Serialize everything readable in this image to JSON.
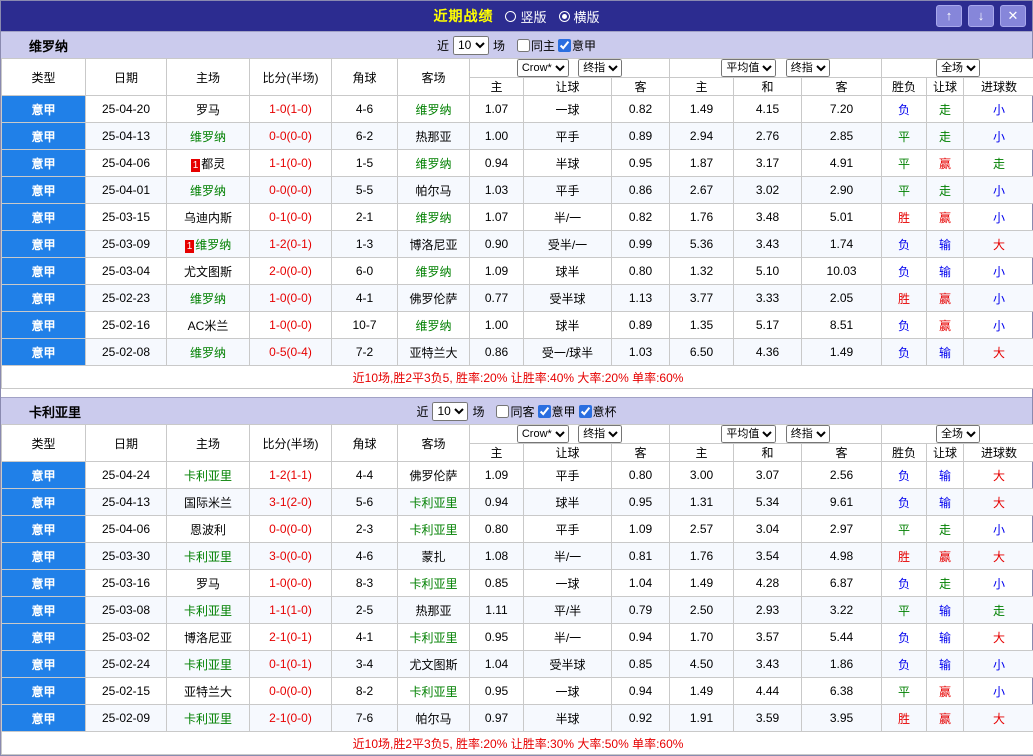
{
  "titlebar": {
    "title": "近期战绩",
    "layout_options": [
      {
        "label": "竖版",
        "selected": false
      },
      {
        "label": "横版",
        "selected": true
      }
    ],
    "buttons": {
      "up": "↑",
      "down": "↓",
      "close": "✕"
    }
  },
  "filter_near_label": "近",
  "filter_unit_label": "场",
  "table_header": {
    "type": "类型",
    "date": "日期",
    "home": "主场",
    "score": "比分(半场)",
    "corner": "角球",
    "away": "客场",
    "odds_selects": [
      "Crow*",
      "终指"
    ],
    "odds_cols": [
      "主",
      "让球",
      "客"
    ],
    "avg_selects": [
      "平均值",
      "终指"
    ],
    "avg_cols": [
      "主",
      "和",
      "客"
    ],
    "result_select": "全场",
    "result_cols": [
      "胜负",
      "让球",
      "进球数"
    ]
  },
  "result_colors": {
    "胜": "#e60000",
    "赢": "#e60000",
    "大": "#e60000",
    "平": "#008000",
    "走": "#008000",
    "负": "#0000ee",
    "输": "#0000ee",
    "小": "#0000ee"
  },
  "colors": {
    "titlebar_bg": "#2c2c90",
    "title_text": "#ffff00",
    "section_bar_bg": "#cbcbed",
    "league_badge_bg": "#2080e8",
    "focus_team": "#008000",
    "score_text": "#e60000"
  },
  "sections": [
    {
      "team": "维罗纳",
      "filter": {
        "count": "10",
        "checkboxes": [
          {
            "label": "同主",
            "checked": false
          },
          {
            "label": "意甲",
            "checked": true
          }
        ]
      },
      "rows": [
        {
          "league": "意甲",
          "date": "25-04-20",
          "home": "罗马",
          "home_focus": false,
          "home_badge": "",
          "score": "1-0(1-0)",
          "corner": "4-6",
          "away": "维罗纳",
          "away_focus": true,
          "away_badge": "",
          "odds": [
            "1.07",
            "一球",
            "0.82"
          ],
          "avg": [
            "1.49",
            "4.15",
            "7.20"
          ],
          "results": [
            "负",
            "走",
            "小"
          ]
        },
        {
          "league": "意甲",
          "date": "25-04-13",
          "home": "维罗纳",
          "home_focus": true,
          "home_badge": "",
          "score": "0-0(0-0)",
          "corner": "6-2",
          "away": "热那亚",
          "away_focus": false,
          "away_badge": "",
          "odds": [
            "1.00",
            "平手",
            "0.89"
          ],
          "avg": [
            "2.94",
            "2.76",
            "2.85"
          ],
          "results": [
            "平",
            "走",
            "小"
          ]
        },
        {
          "league": "意甲",
          "date": "25-04-06",
          "home": "都灵",
          "home_focus": false,
          "home_badge": "1",
          "score": "1-1(0-0)",
          "corner": "1-5",
          "away": "维罗纳",
          "away_focus": true,
          "away_badge": "",
          "odds": [
            "0.94",
            "半球",
            "0.95"
          ],
          "avg": [
            "1.87",
            "3.17",
            "4.91"
          ],
          "results": [
            "平",
            "赢",
            "走"
          ]
        },
        {
          "league": "意甲",
          "date": "25-04-01",
          "home": "维罗纳",
          "home_focus": true,
          "home_badge": "",
          "score": "0-0(0-0)",
          "corner": "5-5",
          "away": "帕尔马",
          "away_focus": false,
          "away_badge": "",
          "odds": [
            "1.03",
            "平手",
            "0.86"
          ],
          "avg": [
            "2.67",
            "3.02",
            "2.90"
          ],
          "results": [
            "平",
            "走",
            "小"
          ]
        },
        {
          "league": "意甲",
          "date": "25-03-15",
          "home": "乌迪内斯",
          "home_focus": false,
          "home_badge": "",
          "score": "0-1(0-0)",
          "corner": "2-1",
          "away": "维罗纳",
          "away_focus": true,
          "away_badge": "",
          "odds": [
            "1.07",
            "半/一",
            "0.82"
          ],
          "avg": [
            "1.76",
            "3.48",
            "5.01"
          ],
          "results": [
            "胜",
            "赢",
            "小"
          ]
        },
        {
          "league": "意甲",
          "date": "25-03-09",
          "home": "维罗纳",
          "home_focus": true,
          "home_badge": "1",
          "score": "1-2(0-1)",
          "corner": "1-3",
          "away": "博洛尼亚",
          "away_focus": false,
          "away_badge": "",
          "odds": [
            "0.90",
            "受半/一",
            "0.99"
          ],
          "avg": [
            "5.36",
            "3.43",
            "1.74"
          ],
          "results": [
            "负",
            "输",
            "大"
          ]
        },
        {
          "league": "意甲",
          "date": "25-03-04",
          "home": "尤文图斯",
          "home_focus": false,
          "home_badge": "",
          "score": "2-0(0-0)",
          "corner": "6-0",
          "away": "维罗纳",
          "away_focus": true,
          "away_badge": "",
          "odds": [
            "1.09",
            "球半",
            "0.80"
          ],
          "avg": [
            "1.32",
            "5.10",
            "10.03"
          ],
          "results": [
            "负",
            "输",
            "小"
          ]
        },
        {
          "league": "意甲",
          "date": "25-02-23",
          "home": "维罗纳",
          "home_focus": true,
          "home_badge": "",
          "score": "1-0(0-0)",
          "corner": "4-1",
          "away": "佛罗伦萨",
          "away_focus": false,
          "away_badge": "",
          "odds": [
            "0.77",
            "受半球",
            "1.13"
          ],
          "avg": [
            "3.77",
            "3.33",
            "2.05"
          ],
          "results": [
            "胜",
            "赢",
            "小"
          ]
        },
        {
          "league": "意甲",
          "date": "25-02-16",
          "home": "AC米兰",
          "home_focus": false,
          "home_badge": "",
          "score": "1-0(0-0)",
          "corner": "10-7",
          "away": "维罗纳",
          "away_focus": true,
          "away_badge": "",
          "odds": [
            "1.00",
            "球半",
            "0.89"
          ],
          "avg": [
            "1.35",
            "5.17",
            "8.51"
          ],
          "results": [
            "负",
            "赢",
            "小"
          ]
        },
        {
          "league": "意甲",
          "date": "25-02-08",
          "home": "维罗纳",
          "home_focus": true,
          "home_badge": "",
          "score": "0-5(0-4)",
          "corner": "7-2",
          "away": "亚特兰大",
          "away_focus": false,
          "away_badge": "",
          "odds": [
            "0.86",
            "受一/球半",
            "1.03"
          ],
          "avg": [
            "6.50",
            "4.36",
            "1.49"
          ],
          "results": [
            "负",
            "输",
            "大"
          ]
        }
      ],
      "summary": "近10场,胜2平3负5, 胜率:20% 让胜率:40% 大率:20% 单率:60%"
    },
    {
      "team": "卡利亚里",
      "filter": {
        "count": "10",
        "checkboxes": [
          {
            "label": "同客",
            "checked": false
          },
          {
            "label": "意甲",
            "checked": true
          },
          {
            "label": "意杯",
            "checked": true
          }
        ]
      },
      "rows": [
        {
          "league": "意甲",
          "date": "25-04-24",
          "home": "卡利亚里",
          "home_focus": true,
          "home_badge": "",
          "score": "1-2(1-1)",
          "corner": "4-4",
          "away": "佛罗伦萨",
          "away_focus": false,
          "away_badge": "",
          "odds": [
            "1.09",
            "平手",
            "0.80"
          ],
          "avg": [
            "3.00",
            "3.07",
            "2.56"
          ],
          "results": [
            "负",
            "输",
            "大"
          ]
        },
        {
          "league": "意甲",
          "date": "25-04-13",
          "home": "国际米兰",
          "home_focus": false,
          "home_badge": "",
          "score": "3-1(2-0)",
          "corner": "5-6",
          "away": "卡利亚里",
          "away_focus": true,
          "away_badge": "",
          "odds": [
            "0.94",
            "球半",
            "0.95"
          ],
          "avg": [
            "1.31",
            "5.34",
            "9.61"
          ],
          "results": [
            "负",
            "输",
            "大"
          ]
        },
        {
          "league": "意甲",
          "date": "25-04-06",
          "home": "恩波利",
          "home_focus": false,
          "home_badge": "",
          "score": "0-0(0-0)",
          "corner": "2-3",
          "away": "卡利亚里",
          "away_focus": true,
          "away_badge": "",
          "odds": [
            "0.80",
            "平手",
            "1.09"
          ],
          "avg": [
            "2.57",
            "3.04",
            "2.97"
          ],
          "results": [
            "平",
            "走",
            "小"
          ]
        },
        {
          "league": "意甲",
          "date": "25-03-30",
          "home": "卡利亚里",
          "home_focus": true,
          "home_badge": "",
          "score": "3-0(0-0)",
          "corner": "4-6",
          "away": "蒙扎",
          "away_focus": false,
          "away_badge": "",
          "odds": [
            "1.08",
            "半/一",
            "0.81"
          ],
          "avg": [
            "1.76",
            "3.54",
            "4.98"
          ],
          "results": [
            "胜",
            "赢",
            "大"
          ]
        },
        {
          "league": "意甲",
          "date": "25-03-16",
          "home": "罗马",
          "home_focus": false,
          "home_badge": "",
          "score": "1-0(0-0)",
          "corner": "8-3",
          "away": "卡利亚里",
          "away_focus": true,
          "away_badge": "",
          "odds": [
            "0.85",
            "一球",
            "1.04"
          ],
          "avg": [
            "1.49",
            "4.28",
            "6.87"
          ],
          "results": [
            "负",
            "走",
            "小"
          ]
        },
        {
          "league": "意甲",
          "date": "25-03-08",
          "home": "卡利亚里",
          "home_focus": true,
          "home_badge": "",
          "score": "1-1(1-0)",
          "corner": "2-5",
          "away": "热那亚",
          "away_focus": false,
          "away_badge": "",
          "odds": [
            "1.11",
            "平/半",
            "0.79"
          ],
          "avg": [
            "2.50",
            "2.93",
            "3.22"
          ],
          "results": [
            "平",
            "输",
            "走"
          ]
        },
        {
          "league": "意甲",
          "date": "25-03-02",
          "home": "博洛尼亚",
          "home_focus": false,
          "home_badge": "",
          "score": "2-1(0-1)",
          "corner": "4-1",
          "away": "卡利亚里",
          "away_focus": true,
          "away_badge": "",
          "odds": [
            "0.95",
            "半/一",
            "0.94"
          ],
          "avg": [
            "1.70",
            "3.57",
            "5.44"
          ],
          "results": [
            "负",
            "输",
            "大"
          ]
        },
        {
          "league": "意甲",
          "date": "25-02-24",
          "home": "卡利亚里",
          "home_focus": true,
          "home_badge": "",
          "score": "0-1(0-1)",
          "corner": "3-4",
          "away": "尤文图斯",
          "away_focus": false,
          "away_badge": "",
          "odds": [
            "1.04",
            "受半球",
            "0.85"
          ],
          "avg": [
            "4.50",
            "3.43",
            "1.86"
          ],
          "results": [
            "负",
            "输",
            "小"
          ]
        },
        {
          "league": "意甲",
          "date": "25-02-15",
          "home": "亚特兰大",
          "home_focus": false,
          "home_badge": "",
          "score": "0-0(0-0)",
          "corner": "8-2",
          "away": "卡利亚里",
          "away_focus": true,
          "away_badge": "",
          "odds": [
            "0.95",
            "一球",
            "0.94"
          ],
          "avg": [
            "1.49",
            "4.44",
            "6.38"
          ],
          "results": [
            "平",
            "赢",
            "小"
          ]
        },
        {
          "league": "意甲",
          "date": "25-02-09",
          "home": "卡利亚里",
          "home_focus": true,
          "home_badge": "",
          "score": "2-1(0-0)",
          "corner": "7-6",
          "away": "帕尔马",
          "away_focus": false,
          "away_badge": "",
          "odds": [
            "0.97",
            "半球",
            "0.92"
          ],
          "avg": [
            "1.91",
            "3.59",
            "3.95"
          ],
          "results": [
            "胜",
            "赢",
            "大"
          ]
        }
      ],
      "summary": "近10场,胜2平3负5, 胜率:20% 让胜率:30% 大率:50% 单率:60%"
    }
  ]
}
